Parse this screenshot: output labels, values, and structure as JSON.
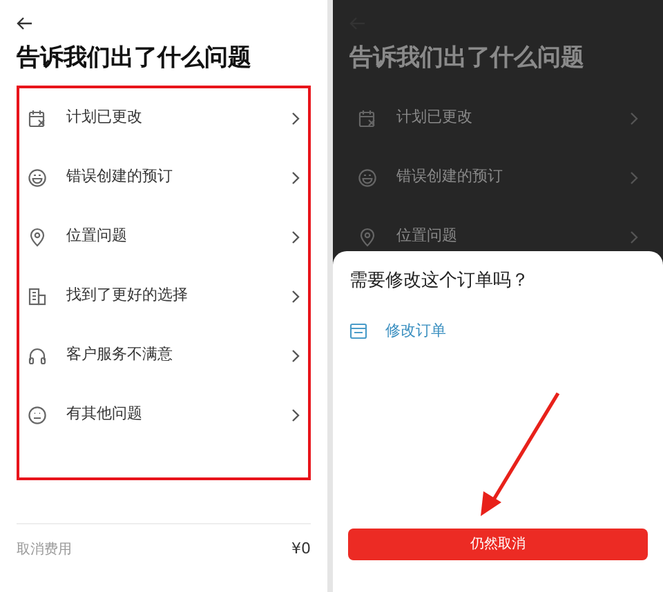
{
  "left_screen": {
    "title": "告诉我们出了什么问题",
    "reasons": [
      {
        "label": "计划已更改"
      },
      {
        "label": "错误创建的预订"
      },
      {
        "label": "位置问题"
      },
      {
        "label": "找到了更好的选择"
      },
      {
        "label": "客户服务不满意"
      },
      {
        "label": "有其他问题"
      }
    ],
    "footer": {
      "label": "取消费用",
      "value": "¥0"
    }
  },
  "right_screen": {
    "dimmed": true,
    "title": "告诉我们出了什么问题",
    "reasons": [
      {
        "label": "计划已更改"
      },
      {
        "label": "错误创建的预订"
      },
      {
        "label": "位置问题"
      }
    ],
    "sheet": {
      "question": "需要修改这个订单吗？",
      "option": "修改订单",
      "button": "仍然取消"
    }
  }
}
